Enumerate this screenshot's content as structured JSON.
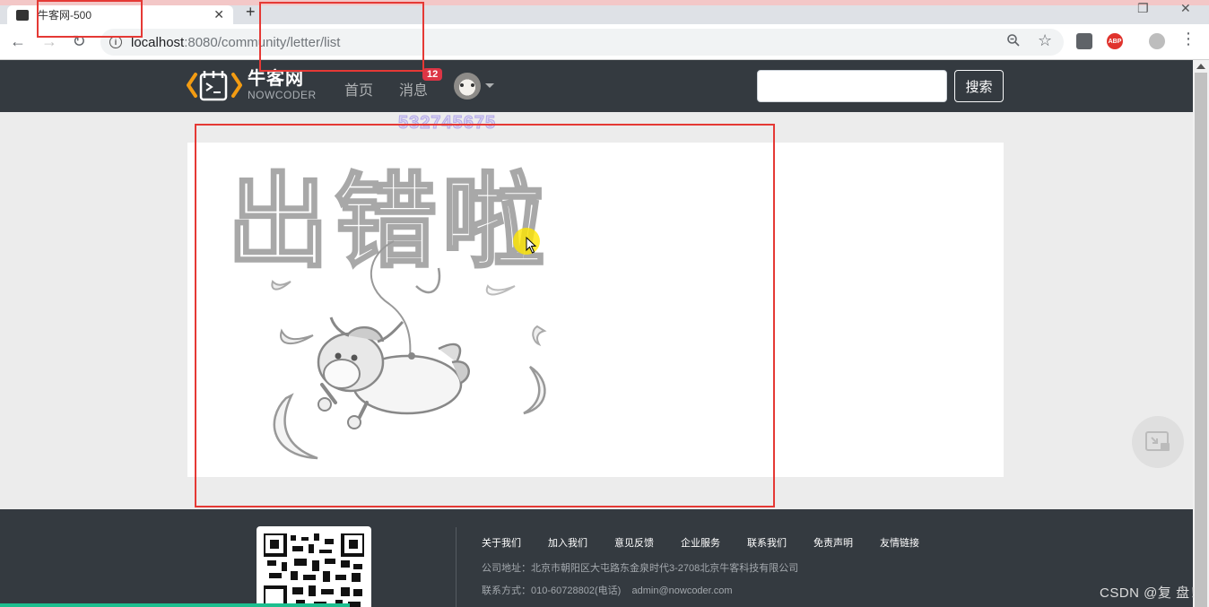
{
  "browser": {
    "tab_title": "牛客网-500",
    "new_tab_label": "+",
    "close_tab_label": "✕",
    "url_host": "localhost",
    "url_rest": ":8080/community/letter/list"
  },
  "header": {
    "logo_cn": "牛客网",
    "logo_en": "NOWCODER",
    "nav_home": "首页",
    "nav_messages": "消息",
    "message_badge": "12",
    "search_placeholder": "",
    "search_button": "搜索"
  },
  "overlay": {
    "watermark_number": "532745675"
  },
  "error_page": {
    "title_text": "出错啦"
  },
  "footer": {
    "links": [
      "关于我们",
      "加入我们",
      "意见反馈",
      "企业服务",
      "联系我们",
      "免责声明",
      "友情链接"
    ],
    "address": "公司地址：北京市朝阳区大屯路东金泉时代3-2708北京牛客科技有限公司",
    "contact": "联系方式：010-60728802(电话)    admin@nowcoder.com"
  },
  "watermark": {
    "csdn": "CSDN @复 盘！"
  },
  "colors": {
    "header_bg": "#343a40",
    "badge": "#dc3545",
    "annotation_red": "#e53935",
    "logo_orange": "#f39c12"
  }
}
